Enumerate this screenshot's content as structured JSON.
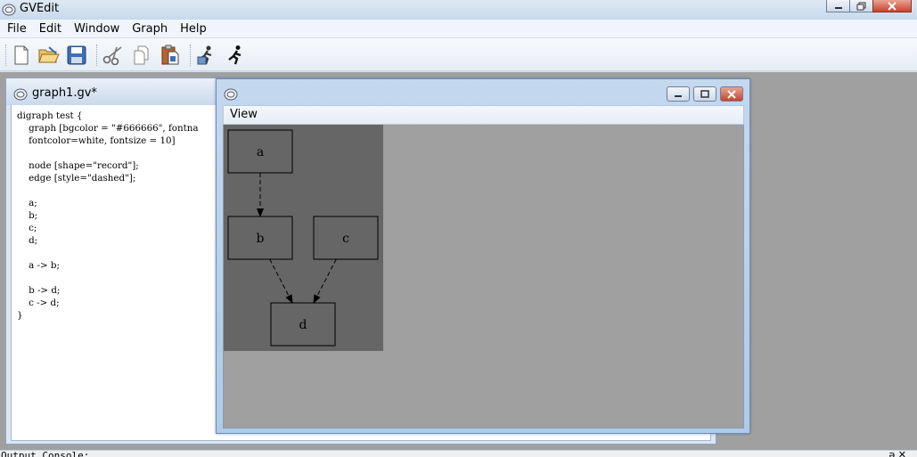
{
  "window": {
    "title": "GVEdit",
    "icon": "graphviz-app-icon"
  },
  "menu": {
    "items": [
      "File",
      "Edit",
      "Window",
      "Graph",
      "Help"
    ]
  },
  "toolbar": {
    "buttons": [
      "new-file-icon",
      "open-folder-icon",
      "save-disk-icon",
      "cut-scissors-icon",
      "copy-icon",
      "paste-icon",
      "settings-runner-icon",
      "run-layout-icon"
    ]
  },
  "editor": {
    "title": "graph1.gv*",
    "source": "digraph test {\n    graph [bgcolor = \"#666666\", fontna\n    fontcolor=white, fontsize = 10]\n\n    node [shape=\"record\"];\n    edge [style=\"dashed\"];\n\n    a;\n    b;\n    c;\n    d;\n\n    a -> b;\n\n    b -> d;\n    c -> d;\n}"
  },
  "viewer": {
    "menu_label": "View",
    "graph": {
      "bgcolor": "#666666",
      "node_stroke": "#000000",
      "nodes": [
        {
          "id": "a",
          "label": "a"
        },
        {
          "id": "b",
          "label": "b"
        },
        {
          "id": "c",
          "label": "c"
        },
        {
          "id": "d",
          "label": "d"
        }
      ],
      "edges": [
        {
          "from": "a",
          "to": "b"
        },
        {
          "from": "b",
          "to": "d"
        },
        {
          "from": "c",
          "to": "d"
        }
      ]
    }
  },
  "console": {
    "title": "Output Console:",
    "controls": "ə ✕"
  }
}
